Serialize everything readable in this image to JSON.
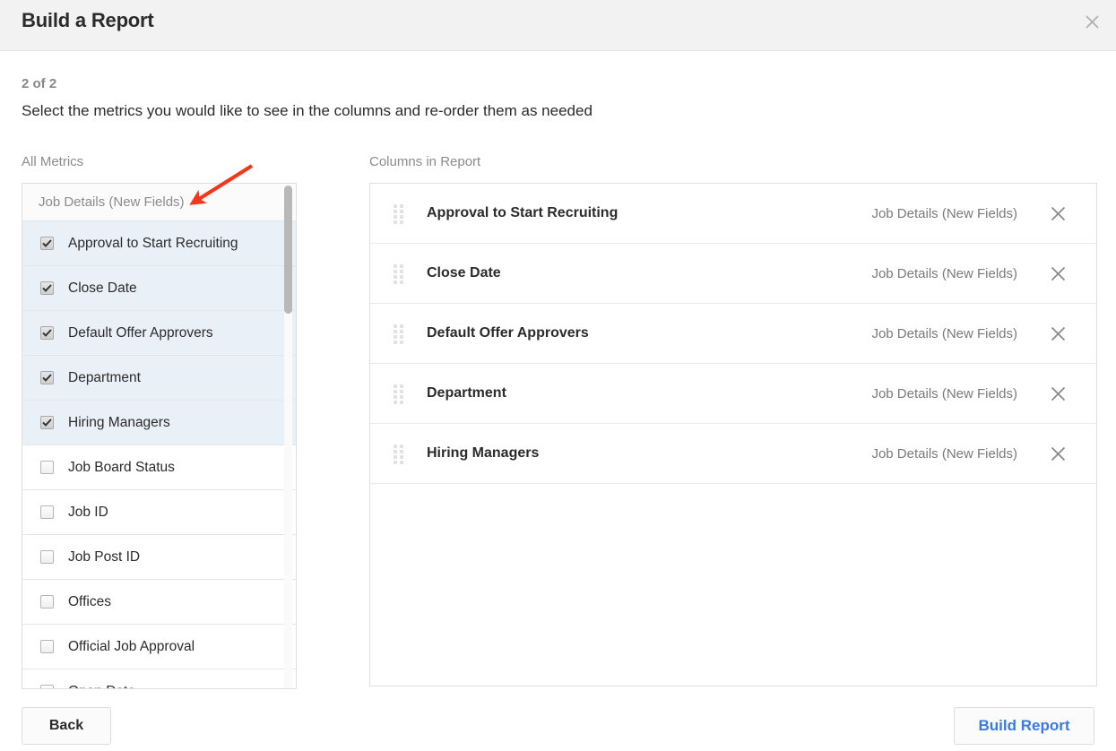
{
  "header": {
    "title": "Build a Report",
    "close_icon": "close-icon"
  },
  "step": {
    "counter": "2 of 2",
    "instructions": "Select the metrics you would like to see in the columns and re-order them as needed"
  },
  "captions": {
    "all_metrics": "All Metrics",
    "columns_in_report": "Columns in Report"
  },
  "metrics_list": {
    "group_label": "Job Details (New Fields)",
    "items": [
      {
        "label": "Approval to Start Recruiting",
        "checked": true
      },
      {
        "label": "Close Date",
        "checked": true
      },
      {
        "label": "Default Offer Approvers",
        "checked": true
      },
      {
        "label": "Department",
        "checked": true
      },
      {
        "label": "Hiring Managers",
        "checked": true
      },
      {
        "label": "Job Board Status",
        "checked": false
      },
      {
        "label": "Job ID",
        "checked": false
      },
      {
        "label": "Job Post ID",
        "checked": false
      },
      {
        "label": "Offices",
        "checked": false
      },
      {
        "label": "Official Job Approval",
        "checked": false
      },
      {
        "label": "Open Date",
        "checked": false
      }
    ]
  },
  "columns_in_report": {
    "rows": [
      {
        "name": "Approval to Start Recruiting",
        "group": "Job Details (New Fields)",
        "remove_icon": "close-icon"
      },
      {
        "name": "Close Date",
        "group": "Job Details (New Fields)",
        "remove_icon": "close-icon"
      },
      {
        "name": "Default Offer Approvers",
        "group": "Job Details (New Fields)",
        "remove_icon": "close-icon"
      },
      {
        "name": "Department",
        "group": "Job Details (New Fields)",
        "remove_icon": "close-icon"
      },
      {
        "name": "Hiring Managers",
        "group": "Job Details (New Fields)",
        "remove_icon": "close-icon"
      }
    ]
  },
  "footer": {
    "back_label": "Back",
    "build_label": "Build Report"
  },
  "colors": {
    "header_bg": "#f2f2f2",
    "selected_row": "#eaf0f8",
    "link_blue": "#3b7ae4",
    "annotation_red": "#f5361a"
  }
}
